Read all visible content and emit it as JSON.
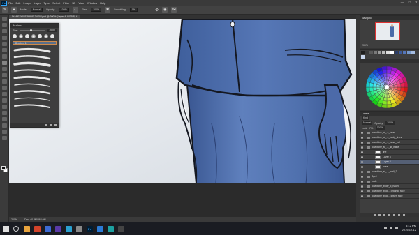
{
  "app": {
    "logo": "Ps",
    "menu": [
      "File",
      "Edit",
      "Image",
      "Layer",
      "Type",
      "Select",
      "Filter",
      "3D",
      "View",
      "Window",
      "Help"
    ],
    "window_controls": [
      "—",
      "□",
      "✕"
    ]
  },
  "options_bar": {
    "mode_label": "Mode:",
    "mode_value": "Normal",
    "opacity_label": "Opacity:",
    "opacity_value": "100%",
    "flow_label": "Flow:",
    "flow_value": "100%",
    "smoothing_label": "Smoothing:",
    "smoothing_value": "0%"
  },
  "document": {
    "tab_title": "DIANE JOSEPHINE 2NEW.psd @ 200% (Layer 4, RGB/8) *"
  },
  "brushes_panel": {
    "title": "Brushes",
    "size_label": "Size:",
    "size_value": "39 px",
    "group_name": "Brushes 1",
    "preset_count": 7
  },
  "navigator": {
    "title": "Navigator",
    "zoom": "200%"
  },
  "swatches_colors": [
    "#1e1e1e",
    "#3a3a3a",
    "#5a5a5a",
    "#7a7a7a",
    "#9a9a9a",
    "#bdbdbd",
    "#dcdcdc",
    "#ffffff",
    "#2c3e6a",
    "#3d5a9a",
    "#5577bb",
    "#7799cc",
    "#a6bde0",
    "#c9d6ec"
  ],
  "layers": {
    "title": "Layers",
    "kind_label": "Kind",
    "blend_mode": "Normal",
    "opacity_label": "Opacity:",
    "opacity_value": "100%",
    "lock_label": "Lock:",
    "fill_label": "Fill:",
    "fill_value": "100%",
    "items": [
      {
        "name": "josephine_st_..._base",
        "folder": true
      },
      {
        "name": "josephine_st_..._body_lines",
        "folder": true
      },
      {
        "name": "josephine_st_..._base_col",
        "folder": true
      },
      {
        "name": "josephine_st_..._st_inline",
        "folder": true
      },
      {
        "name": "line",
        "folder": false
      },
      {
        "name": "Layer 5",
        "folder": false
      },
      {
        "name": "Layer 4",
        "folder": false,
        "active": true
      },
      {
        "name": "base",
        "folder": false
      },
      {
        "name": "josephine_st_..._wall_2",
        "folder": true
      },
      {
        "name": "Bgrd",
        "folder": true
      },
      {
        "name": "body",
        "folder": true
      },
      {
        "name": "josephine_body_5_naked",
        "folder": true
      },
      {
        "name": "josephine_bod..._organic_face",
        "folder": true
      },
      {
        "name": "josephine_bod..._lower_face",
        "folder": true
      }
    ]
  },
  "status_bar": {
    "zoom": "200%",
    "doc_size": "Doc: 40.3M/262.0M"
  },
  "taskbar": {
    "time": "4:12 PM",
    "date": "2019-12-12"
  }
}
